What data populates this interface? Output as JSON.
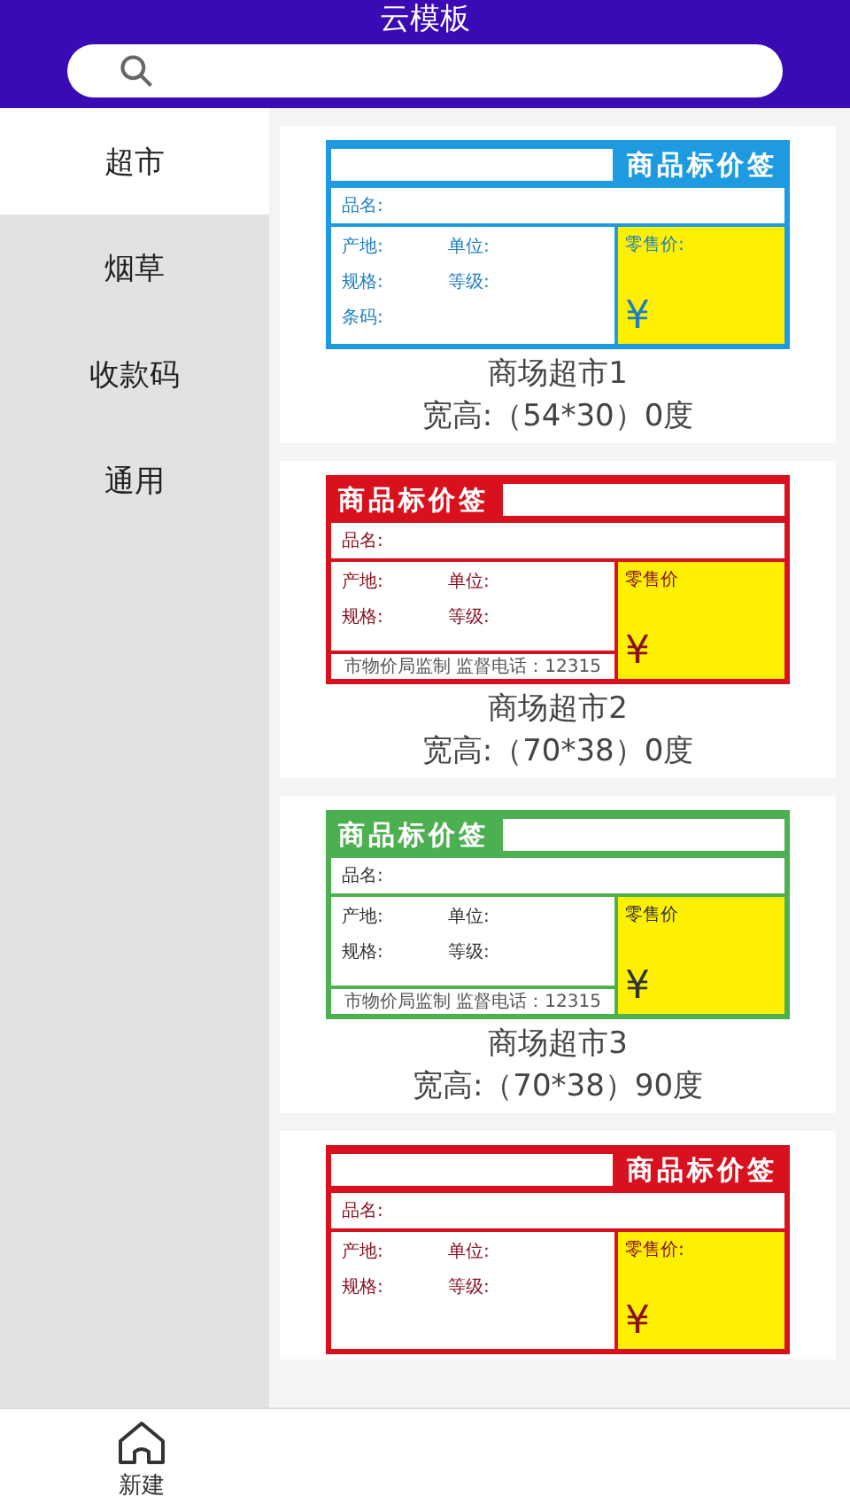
{
  "header": {
    "title": "云模板"
  },
  "sidebar": {
    "items": [
      {
        "label": "超市",
        "selected": true
      },
      {
        "label": "烟草",
        "selected": false
      },
      {
        "label": "收款码",
        "selected": false
      },
      {
        "label": "通用",
        "selected": false
      }
    ]
  },
  "templates": [
    {
      "tag": {
        "kind": "heading-right",
        "color": "#1e9be0",
        "heading": "商品标价签",
        "name_label": "品名:",
        "fields": [
          [
            "产地:",
            "单位:"
          ],
          [
            "规格:",
            "等级:"
          ],
          [
            "条码:"
          ]
        ],
        "price_label": "零售价:",
        "currency": "¥"
      },
      "name": "商场超市1",
      "size": "宽高:（54*30）0度"
    },
    {
      "tag": {
        "kind": "heading-left",
        "color": "#d9101e",
        "heading": "商品标价签",
        "name_label": "品名:",
        "fields": [
          [
            "产地:",
            "单位:"
          ],
          [
            "规格:",
            "等级:"
          ]
        ],
        "price_label": "零售价",
        "currency": "¥",
        "footer": "市物价局监制 监督电话：12315"
      },
      "name": "商场超市2",
      "size": "宽高:（70*38）0度"
    },
    {
      "tag": {
        "kind": "heading-left",
        "color": "#4caf50",
        "heading": "商品标价签",
        "name_label": "品名:",
        "fields": [
          [
            "产地:",
            "单位:"
          ],
          [
            "规格:",
            "等级:"
          ]
        ],
        "price_label": "零售价",
        "currency": "¥",
        "footer": "市物价局监制 监督电话：12315"
      },
      "name": "商场超市3",
      "size": "宽高:（70*38）90度"
    },
    {
      "tag": {
        "kind": "heading-right",
        "color": "#d9101e",
        "heading": "商品标价签",
        "name_label": "品名:",
        "fields": [
          [
            "产地:",
            "单位:"
          ],
          [
            "规格:",
            "等级:"
          ]
        ],
        "price_label": "零售价:",
        "currency": "¥"
      }
    }
  ],
  "bottom_nav": {
    "items": [
      {
        "label": "新建"
      }
    ]
  }
}
